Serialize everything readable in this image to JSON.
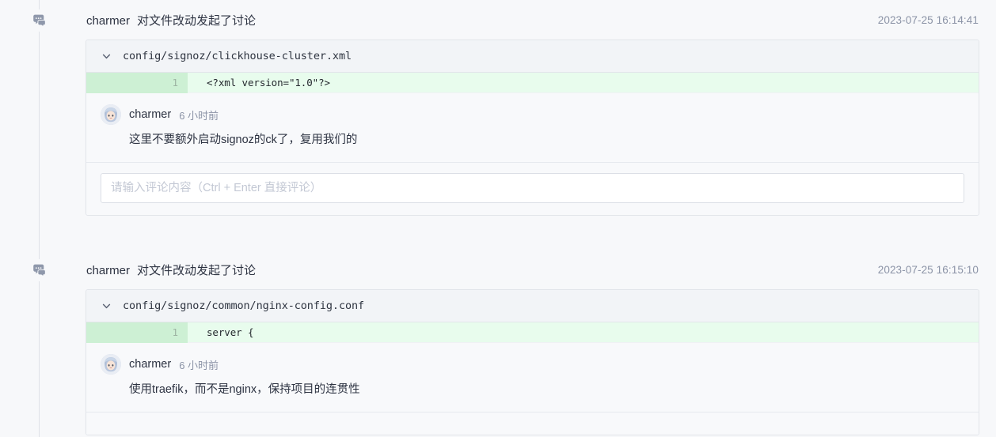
{
  "theme": {
    "page_background": "#f7f8fa",
    "card_background": "#f8f9fb",
    "file_bar_background": "#f2f4f7",
    "code_added_background": "#e8fced",
    "code_gutter_background": "#cdf0d4",
    "border": "#e2e5ea",
    "text_primary": "#2d3342",
    "text_muted": "#8b93a6",
    "timeline_line": "#dfe2e8"
  },
  "timeline": {
    "node_icon": "comment-bubbles-icon"
  },
  "events": [
    {
      "author": "charmer",
      "action": "对文件改动发起了讨论",
      "timestamp": "2023-07-25 16:14:41",
      "file": {
        "path": "config/signoz/clickhouse-cluster.xml",
        "collapse_icon": "chevron-down-icon"
      },
      "code": {
        "line_number": "1",
        "content": "<?xml version=\"1.0\"?>"
      },
      "comments": [
        {
          "avatar": "user-avatar",
          "author": "charmer",
          "ago": "6 小时前",
          "text": "这里不要额外启动signoz的ck了，复用我们的"
        }
      ],
      "reply": {
        "value": "",
        "placeholder": "请输入评论内容（Ctrl + Enter 直接评论）"
      }
    },
    {
      "author": "charmer",
      "action": "对文件改动发起了讨论",
      "timestamp": "2023-07-25 16:15:10",
      "file": {
        "path": "config/signoz/common/nginx-config.conf",
        "collapse_icon": "chevron-down-icon"
      },
      "code": {
        "line_number": "1",
        "content": "server {"
      },
      "comments": [
        {
          "avatar": "user-avatar",
          "author": "charmer",
          "ago": "6 小时前",
          "text": "使用traefik，而不是nginx，保持项目的连贯性"
        }
      ]
    }
  ]
}
